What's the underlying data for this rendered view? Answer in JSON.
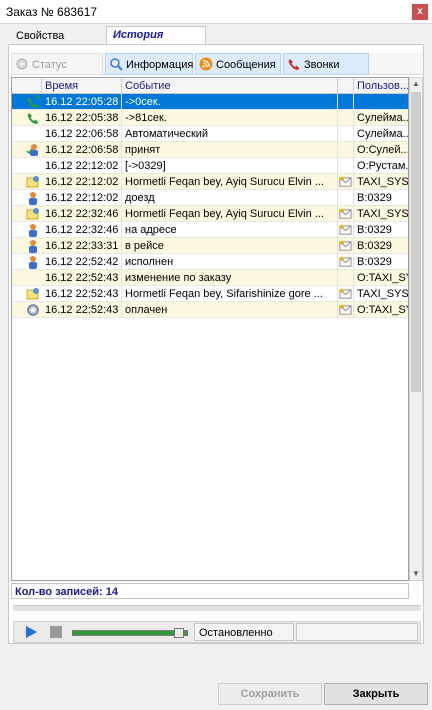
{
  "window": {
    "title": "Заказ № 683617",
    "close_label": "x"
  },
  "tabs": [
    {
      "label": "Свойства"
    },
    {
      "label": "История"
    }
  ],
  "subtabs": [
    {
      "label": "Статус",
      "icon": "status-icon"
    },
    {
      "label": "Информация",
      "icon": "search-icon"
    },
    {
      "label": "Сообщения",
      "icon": "rss-icon"
    },
    {
      "label": "Звонки",
      "icon": "phone-icon"
    }
  ],
  "grid": {
    "columns": [
      "Время",
      "Событие",
      "Пользов..."
    ],
    "rows": [
      {
        "icon": "phone-incoming-icon",
        "time": "16.12 22:05:28",
        "event": "->0сек.",
        "user": "",
        "msg": false,
        "selected": true
      },
      {
        "icon": "phone-icon",
        "time": "16.12 22:05:38",
        "event": "->81сек.",
        "user": "Сулейма...",
        "msg": false
      },
      {
        "icon": "",
        "time": "16.12 22:06:58",
        "event": "Автоматический",
        "user": "Сулейма...",
        "msg": false
      },
      {
        "icon": "user-accept-icon",
        "time": "16.12 22:06:58",
        "event": "принят",
        "user": "O:Сулей...",
        "msg": false
      },
      {
        "icon": "",
        "time": "16.12 22:12:02",
        "event": "[->0329]",
        "user": "O:Рустам...",
        "msg": false
      },
      {
        "icon": "message-icon",
        "time": "16.12 22:12:02",
        "event": "Hormetli Feqan bey, Ayiq Surucu Elvin ...",
        "user": "TAXI_SYST...",
        "msg": true
      },
      {
        "icon": "driver-icon",
        "time": "16.12 22:12:02",
        "event": "доезд",
        "user": "B:0329",
        "msg": false
      },
      {
        "icon": "message-icon",
        "time": "16.12 22:32:46",
        "event": "Hormetli Feqan bey, Ayiq Surucu Elvin ...",
        "user": "TAXI_SYST...",
        "msg": true
      },
      {
        "icon": "driver-icon",
        "time": "16.12 22:32:46",
        "event": "на адресе",
        "user": "B:0329",
        "msg": true
      },
      {
        "icon": "driver-icon",
        "time": "16.12 22:33:31",
        "event": "в рейсе",
        "user": "B:0329",
        "msg": true
      },
      {
        "icon": "driver-icon",
        "time": "16.12 22:52:42",
        "event": "исполнен",
        "user": "B:0329",
        "msg": true
      },
      {
        "icon": "",
        "time": "16.12 22:52:43",
        "event": "изменение по заказу",
        "user": "O:TAXI_SY...",
        "msg": false
      },
      {
        "icon": "message-icon",
        "time": "16.12 22:52:43",
        "event": "Hormetli Feqan bey, Sifarishinize gore ...",
        "user": "TAXI_SYST...",
        "msg": true
      },
      {
        "icon": "settings-icon",
        "time": "16.12 22:52:43",
        "event": "оплачен",
        "user": "O:TAXI_SY...",
        "msg": true
      }
    ]
  },
  "footer": {
    "count_label": "Кол-во записей: 14"
  },
  "player": {
    "status": "Остановленно"
  },
  "buttons": {
    "save": "Сохранить",
    "close": "Закрыть"
  },
  "colors": {
    "selected_row": "#0078d7",
    "alt_row": "#fdf9e1",
    "header_text": "#1a1a8a",
    "slider": "#2e9b3a"
  }
}
